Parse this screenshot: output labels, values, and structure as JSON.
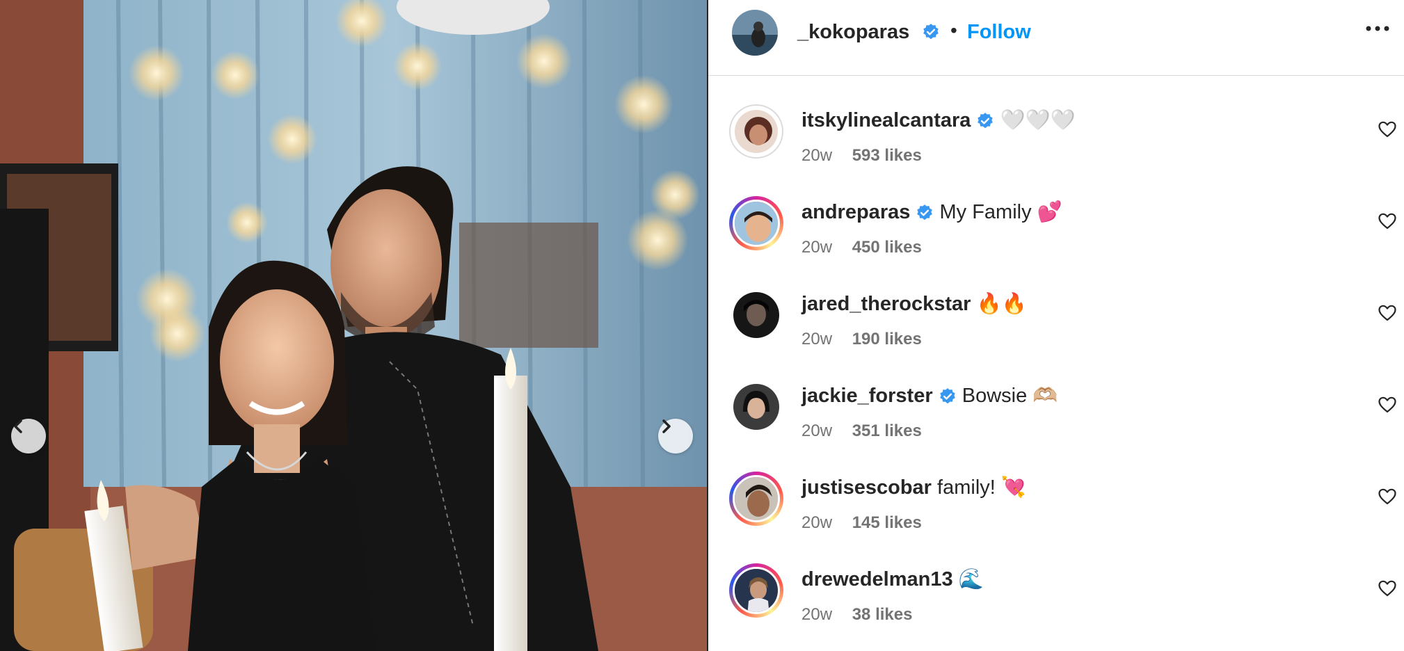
{
  "post": {
    "author": "_kokoparas",
    "author_verified": true,
    "separator": "•",
    "follow_label": "Follow",
    "accent_color": "#0095f6"
  },
  "comments": [
    {
      "username": "itskylinealcantara",
      "verified": true,
      "text": "🤍🤍🤍",
      "age": "20w",
      "likes": "593 likes",
      "ring": "grey"
    },
    {
      "username": "andreparas",
      "verified": true,
      "text": "My Family 💕",
      "age": "20w",
      "likes": "450 likes",
      "ring": "story"
    },
    {
      "username": "jared_therockstar",
      "verified": false,
      "text": "🔥🔥",
      "age": "20w",
      "likes": "190 likes",
      "ring": "none"
    },
    {
      "username": "jackie_forster",
      "verified": true,
      "text": "Bowsie 🫶🏼",
      "age": "20w",
      "likes": "351 likes",
      "ring": "none"
    },
    {
      "username": "justisescobar",
      "verified": false,
      "text": "family! 💘",
      "age": "20w",
      "likes": "145 likes",
      "ring": "story"
    },
    {
      "username": "drewedelman13",
      "verified": false,
      "text": "🌊",
      "age": "20w",
      "likes": "38 likes",
      "ring": "story"
    }
  ],
  "icons": {
    "prev": "chevron-left-icon",
    "next": "chevron-right-icon",
    "more": "more-options-icon",
    "like": "heart-icon",
    "verified": "verified-badge-icon"
  }
}
